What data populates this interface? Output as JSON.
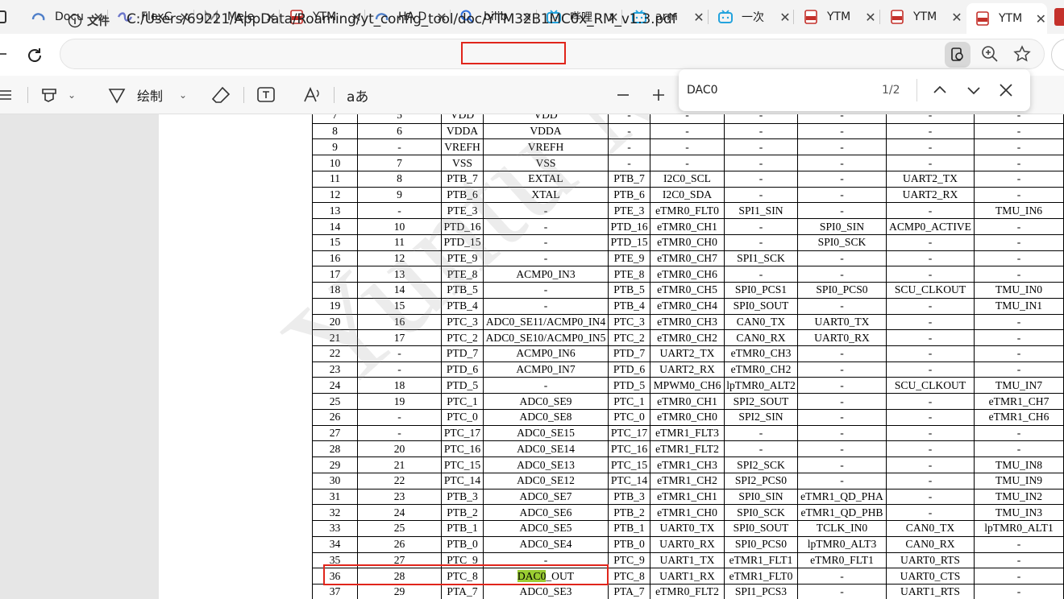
{
  "tabs": [
    {
      "title": "Docu",
      "icon": "cloud-icon",
      "active": false
    },
    {
      "title": "FlexC",
      "icon": "flex-icon",
      "active": false
    },
    {
      "title": "Mele",
      "icon": "m-logo-icon",
      "active": false
    },
    {
      "title": "YTM",
      "icon": "pdf-icon",
      "active": false
    },
    {
      "title": "HA D",
      "icon": "cloud-icon",
      "active": false
    },
    {
      "title": "bilib",
      "icon": "search-icon",
      "active": false
    },
    {
      "title": "哔哩",
      "icon": "bilibili-icon",
      "active": false
    },
    {
      "title": "arm",
      "icon": "bilibili-icon",
      "active": false
    },
    {
      "title": "一次",
      "icon": "bilibili-icon",
      "active": false
    },
    {
      "title": "YTM",
      "icon": "pdf-icon",
      "active": false
    },
    {
      "title": "YTM",
      "icon": "pdf-icon",
      "active": false
    },
    {
      "title": "YTM",
      "icon": "pdf-icon",
      "active": true
    }
  ],
  "address": {
    "info_label": "文件",
    "url_before": "C:/Users/69221/AppData/Roaming/yt_config_tool/doc",
    "url_highlight": "/YTM32B1MC0x",
    "url_after": "_RM_v1.3.pdf"
  },
  "pdf_toolbar": {
    "draw_label": "绘制",
    "translate_label": "aあ"
  },
  "find": {
    "query": "DAC0",
    "count": "1/2"
  },
  "watermark": "Yuntu Mi",
  "table": {
    "rows": [
      [
        "7",
        "5",
        "VDD",
        "VDD",
        "-",
        "-",
        "-",
        "-",
        "-",
        "-"
      ],
      [
        "8",
        "6",
        "VDDA",
        "VDDA",
        "-",
        "-",
        "-",
        "-",
        "-",
        "-"
      ],
      [
        "9",
        "-",
        "VREFH",
        "VREFH",
        "-",
        "-",
        "-",
        "-",
        "-",
        "-"
      ],
      [
        "10",
        "7",
        "VSS",
        "VSS",
        "-",
        "-",
        "-",
        "-",
        "-",
        "-"
      ],
      [
        "11",
        "8",
        "PTB_7",
        "EXTAL",
        "PTB_7",
        "I2C0_SCL",
        "-",
        "-",
        "UART2_TX",
        "-"
      ],
      [
        "12",
        "9",
        "PTB_6",
        "XTAL",
        "PTB_6",
        "I2C0_SDA",
        "-",
        "-",
        "UART2_RX",
        "-"
      ],
      [
        "13",
        "-",
        "PTE_3",
        "-",
        "PTE_3",
        "eTMR0_FLT0",
        "SPI1_SIN",
        "-",
        "-",
        "TMU_IN6"
      ],
      [
        "14",
        "10",
        "PTD_16",
        "-",
        "PTD_16",
        "eTMR0_CH1",
        "-",
        "SPI0_SIN",
        "ACMP0_ACTIVE",
        "-"
      ],
      [
        "15",
        "11",
        "PTD_15",
        "-",
        "PTD_15",
        "eTMR0_CH0",
        "-",
        "SPI0_SCK",
        "-",
        "-"
      ],
      [
        "16",
        "12",
        "PTE_9",
        "-",
        "PTE_9",
        "eTMR0_CH7",
        "SPI1_SCK",
        "-",
        "-",
        "-"
      ],
      [
        "17",
        "13",
        "PTE_8",
        "ACMP0_IN3",
        "PTE_8",
        "eTMR0_CH6",
        "-",
        "-",
        "-",
        "-"
      ],
      [
        "18",
        "14",
        "PTB_5",
        "-",
        "PTB_5",
        "eTMR0_CH5",
        "SPI0_PCS1",
        "SPI0_PCS0",
        "SCU_CLKOUT",
        "TMU_IN0"
      ],
      [
        "19",
        "15",
        "PTB_4",
        "-",
        "PTB_4",
        "eTMR0_CH4",
        "SPI0_SOUT",
        "-",
        "-",
        "TMU_IN1"
      ],
      [
        "20",
        "16",
        "PTC_3",
        "ADC0_SE11/ACMP0_IN4",
        "PTC_3",
        "eTMR0_CH3",
        "CAN0_TX",
        "UART0_TX",
        "-",
        "-"
      ],
      [
        "21",
        "17",
        "PTC_2",
        "ADC0_SE10/ACMP0_IN5",
        "PTC_2",
        "eTMR0_CH2",
        "CAN0_RX",
        "UART0_RX",
        "-",
        "-"
      ],
      [
        "22",
        "-",
        "PTD_7",
        "ACMP0_IN6",
        "PTD_7",
        "UART2_TX",
        "eTMR0_CH3",
        "-",
        "-",
        "-"
      ],
      [
        "23",
        "-",
        "PTD_6",
        "ACMP0_IN7",
        "PTD_6",
        "UART2_RX",
        "eTMR0_CH2",
        "-",
        "-",
        "-"
      ],
      [
        "24",
        "18",
        "PTD_5",
        "-",
        "PTD_5",
        "MPWM0_CH6",
        "lpTMR0_ALT2",
        "-",
        "SCU_CLKOUT",
        "TMU_IN7"
      ],
      [
        "25",
        "19",
        "PTC_1",
        "ADC0_SE9",
        "PTC_1",
        "eTMR0_CH1",
        "SPI2_SOUT",
        "-",
        "-",
        "eTMR1_CH7"
      ],
      [
        "26",
        "-",
        "PTC_0",
        "ADC0_SE8",
        "PTC_0",
        "eTMR0_CH0",
        "SPI2_SIN",
        "-",
        "-",
        "eTMR1_CH6"
      ],
      [
        "27",
        "-",
        "PTC_17",
        "ADC0_SE15",
        "PTC_17",
        "eTMR1_FLT3",
        "-",
        "-",
        "-",
        "-"
      ],
      [
        "28",
        "20",
        "PTC_16",
        "ADC0_SE14",
        "PTC_16",
        "eTMR1_FLT2",
        "-",
        "-",
        "-",
        "-"
      ],
      [
        "29",
        "21",
        "PTC_15",
        "ADC0_SE13",
        "PTC_15",
        "eTMR1_CH3",
        "SPI2_SCK",
        "-",
        "-",
        "TMU_IN8"
      ],
      [
        "30",
        "22",
        "PTC_14",
        "ADC0_SE12",
        "PTC_14",
        "eTMR1_CH2",
        "SPI2_PCS0",
        "-",
        "-",
        "TMU_IN9"
      ],
      [
        "31",
        "23",
        "PTB_3",
        "ADC0_SE7",
        "PTB_3",
        "eTMR1_CH1",
        "SPI0_SIN",
        "eTMR1_QD_PHA",
        "-",
        "TMU_IN2"
      ],
      [
        "32",
        "24",
        "PTB_2",
        "ADC0_SE6",
        "PTB_2",
        "eTMR1_CH0",
        "SPI0_SCK",
        "eTMR1_QD_PHB",
        "-",
        "TMU_IN3"
      ],
      [
        "33",
        "25",
        "PTB_1",
        "ADC0_SE5",
        "PTB_1",
        "UART0_TX",
        "SPI0_SOUT",
        "TCLK_IN0",
        "CAN0_TX",
        "lpTMR0_ALT1"
      ],
      [
        "34",
        "26",
        "PTB_0",
        "ADC0_SE4",
        "PTB_0",
        "UART0_RX",
        "SPI0_PCS0",
        "lpTMR0_ALT3",
        "CAN0_RX",
        "-"
      ],
      [
        "35",
        "27",
        "PTC_9",
        "-",
        "PTC_9",
        "UART1_TX",
        "eTMR1_FLT1",
        "eTMR0_FLT1",
        "UART0_RTS",
        "-"
      ],
      [
        "36",
        "28",
        "PTC_8",
        "DAC0_OUT",
        "PTC_8",
        "UART1_RX",
        "eTMR1_FLT0",
        "-",
        "UART0_CTS",
        "-"
      ],
      [
        "37",
        "29",
        "PTA_7",
        "ADC0_SE3",
        "PTA_7",
        "eTMR0_FLT2",
        "SPI1_PCS3",
        "-",
        "UART1_RTS",
        "-"
      ]
    ]
  }
}
